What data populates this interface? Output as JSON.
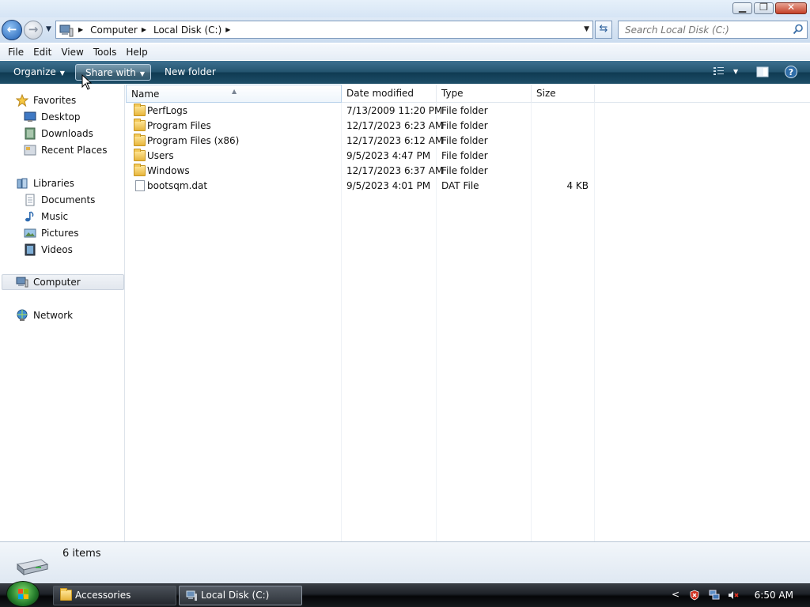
{
  "window": {
    "controls": {
      "minimize": "▁",
      "maximize": "❐",
      "close": "✕"
    }
  },
  "address": {
    "breadcrumbs": [
      "Computer",
      "Local Disk (C:)"
    ],
    "search_placeholder": "Search Local Disk (C:)"
  },
  "menu": [
    "File",
    "Edit",
    "View",
    "Tools",
    "Help"
  ],
  "toolbar": {
    "organize": "Organize",
    "share_with": "Share with",
    "new_folder": "New folder"
  },
  "sidebar": {
    "favorites": {
      "label": "Favorites",
      "items": [
        "Desktop",
        "Downloads",
        "Recent Places"
      ]
    },
    "libraries": {
      "label": "Libraries",
      "items": [
        "Documents",
        "Music",
        "Pictures",
        "Videos"
      ]
    },
    "computer": "Computer",
    "network": "Network"
  },
  "columns": {
    "name": "Name",
    "date": "Date modified",
    "type": "Type",
    "size": "Size"
  },
  "files": [
    {
      "name": "PerfLogs",
      "date": "7/13/2009 11:20 PM",
      "type": "File folder",
      "size": "",
      "kind": "folder"
    },
    {
      "name": "Program Files",
      "date": "12/17/2023 6:23 AM",
      "type": "File folder",
      "size": "",
      "kind": "folder"
    },
    {
      "name": "Program Files (x86)",
      "date": "12/17/2023 6:12 AM",
      "type": "File folder",
      "size": "",
      "kind": "folder"
    },
    {
      "name": "Users",
      "date": "9/5/2023 4:47 PM",
      "type": "File folder",
      "size": "",
      "kind": "folder"
    },
    {
      "name": "Windows",
      "date": "12/17/2023 6:37 AM",
      "type": "File folder",
      "size": "",
      "kind": "folder"
    },
    {
      "name": "bootsqm.dat",
      "date": "9/5/2023 4:01 PM",
      "type": "DAT File",
      "size": "4 KB",
      "kind": "file"
    }
  ],
  "status": {
    "item_count": "6 items"
  },
  "taskbar": {
    "tasks": [
      "Accessories",
      "Local Disk (C:)"
    ],
    "clock": "6:50 AM"
  },
  "colors": {
    "command_bar": "#24546f",
    "taskbar": "#1d2127",
    "folder": "#e7b53c"
  }
}
